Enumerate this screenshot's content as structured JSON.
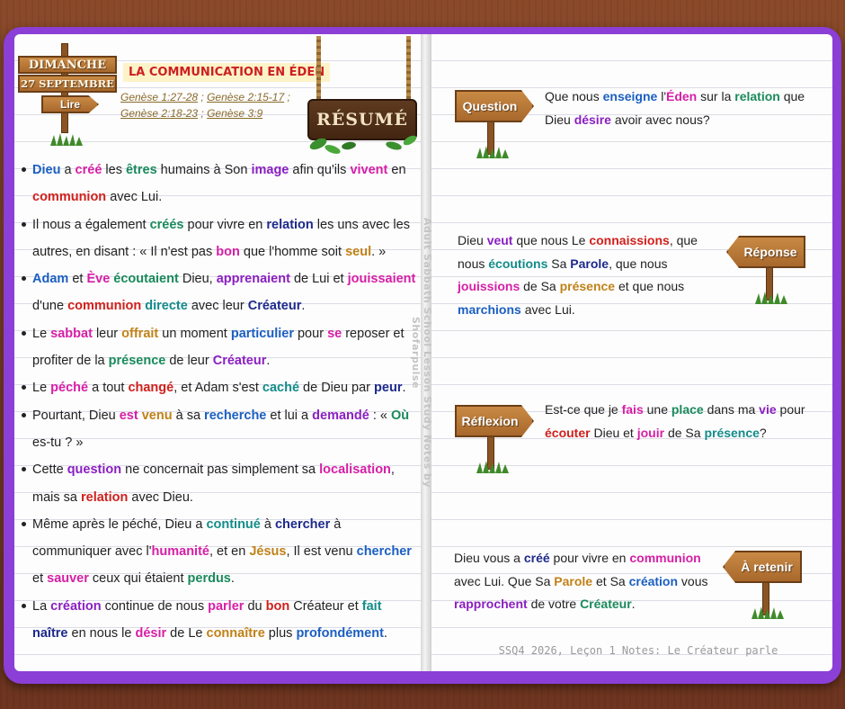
{
  "left_page": {
    "day_sign": {
      "day": "DIMANCHE",
      "date": "27 SEPTEMBRE",
      "read_label": "Lire"
    },
    "title": "LA COMMUNICATION EN ÉDEN",
    "references": [
      "Genèse 1:27-28",
      "Genèse 2:15-17",
      "Genèse 2:18-23",
      "Genèse 3:9"
    ],
    "resume_label": "RÉSUMÉ",
    "bullets": [
      [
        {
          "t": "Dieu",
          "c": "blue"
        },
        {
          "t": " a "
        },
        {
          "t": "créé",
          "c": "mag"
        },
        {
          "t": " les "
        },
        {
          "t": "êtres",
          "c": "grn"
        },
        {
          "t": " humains à Son "
        },
        {
          "t": "image",
          "c": "pur"
        },
        {
          "t": " afin qu'ils "
        },
        {
          "t": "vivent",
          "c": "mag"
        },
        {
          "t": " en "
        },
        {
          "t": "communion",
          "c": "red"
        },
        {
          "t": " avec Lui."
        }
      ],
      [
        {
          "t": "Il nous a également "
        },
        {
          "t": "créés",
          "c": "grn"
        },
        {
          "t": " pour vivre en "
        },
        {
          "t": "relation",
          "c": "navy"
        },
        {
          "t": " les uns avec les autres, en disant : « Il n'est pas "
        },
        {
          "t": "bon",
          "c": "mag"
        },
        {
          "t": " que l'homme soit "
        },
        {
          "t": "seul",
          "c": "gold"
        },
        {
          "t": ". »"
        }
      ],
      [
        {
          "t": "Adam",
          "c": "blue"
        },
        {
          "t": " et "
        },
        {
          "t": "Ève",
          "c": "mag"
        },
        {
          "t": " "
        },
        {
          "t": "écoutaient",
          "c": "grn"
        },
        {
          "t": " Dieu, "
        },
        {
          "t": "apprenaient",
          "c": "pur"
        },
        {
          "t": " de Lui et "
        },
        {
          "t": "jouissaient",
          "c": "mag"
        },
        {
          "t": " d'une "
        },
        {
          "t": "communion",
          "c": "red"
        },
        {
          "t": " "
        },
        {
          "t": "directe",
          "c": "teal"
        },
        {
          "t": " avec leur "
        },
        {
          "t": "Créateur",
          "c": "navy"
        },
        {
          "t": "."
        }
      ],
      [
        {
          "t": "Le "
        },
        {
          "t": "sabbat",
          "c": "mag"
        },
        {
          "t": " leur "
        },
        {
          "t": "offrait",
          "c": "gold"
        },
        {
          "t": " un moment "
        },
        {
          "t": "particulier",
          "c": "blue"
        },
        {
          "t": " pour "
        },
        {
          "t": "se",
          "c": "mag"
        },
        {
          "t": " reposer et profiter de la "
        },
        {
          "t": "présence",
          "c": "grn"
        },
        {
          "t": " de leur "
        },
        {
          "t": "Créateur",
          "c": "pur"
        },
        {
          "t": "."
        }
      ],
      [
        {
          "t": "Le "
        },
        {
          "t": "péché",
          "c": "mag"
        },
        {
          "t": " a tout "
        },
        {
          "t": "changé",
          "c": "red"
        },
        {
          "t": ", et Adam s'est "
        },
        {
          "t": "caché",
          "c": "teal"
        },
        {
          "t": " de Dieu par "
        },
        {
          "t": "peur",
          "c": "navy"
        },
        {
          "t": "."
        }
      ],
      [
        {
          "t": "Pourtant, Dieu "
        },
        {
          "t": "est",
          "c": "mag"
        },
        {
          "t": " "
        },
        {
          "t": "venu",
          "c": "gold"
        },
        {
          "t": " à sa "
        },
        {
          "t": "recherche",
          "c": "blue"
        },
        {
          "t": " et lui a "
        },
        {
          "t": "demandé",
          "c": "pur"
        },
        {
          "t": " : « "
        },
        {
          "t": "Où",
          "c": "grn"
        },
        {
          "t": " es-tu ? »"
        }
      ],
      [
        {
          "t": "Cette "
        },
        {
          "t": "question",
          "c": "pur"
        },
        {
          "t": " ne concernait pas simplement sa "
        },
        {
          "t": "localisation",
          "c": "mag"
        },
        {
          "t": ", mais sa "
        },
        {
          "t": "relation",
          "c": "red"
        },
        {
          "t": " avec Dieu."
        }
      ],
      [
        {
          "t": "Même après le péché, Dieu a "
        },
        {
          "t": "continué",
          "c": "teal"
        },
        {
          "t": " à "
        },
        {
          "t": "chercher",
          "c": "navy"
        },
        {
          "t": " à communiquer avec l'"
        },
        {
          "t": "humanité",
          "c": "mag"
        },
        {
          "t": ", et en "
        },
        {
          "t": "Jésus",
          "c": "gold"
        },
        {
          "t": ", Il est venu "
        },
        {
          "t": "chercher",
          "c": "blue"
        },
        {
          "t": " et "
        },
        {
          "t": "sauver",
          "c": "mag"
        },
        {
          "t": " ceux qui étaient "
        },
        {
          "t": "perdus",
          "c": "grn"
        },
        {
          "t": "."
        }
      ],
      [
        {
          "t": "La "
        },
        {
          "t": "création",
          "c": "pur"
        },
        {
          "t": " continue de nous "
        },
        {
          "t": "parler",
          "c": "mag"
        },
        {
          "t": " du "
        },
        {
          "t": "bon",
          "c": "red"
        },
        {
          "t": " Créateur et "
        },
        {
          "t": "fait",
          "c": "teal"
        },
        {
          "t": " "
        },
        {
          "t": "naître",
          "c": "navy"
        },
        {
          "t": " en nous le "
        },
        {
          "t": "désir",
          "c": "mag"
        },
        {
          "t": " de Le "
        },
        {
          "t": "connaître",
          "c": "gold"
        },
        {
          "t": " plus "
        },
        {
          "t": "profondément",
          "c": "blue"
        },
        {
          "t": "."
        }
      ]
    ]
  },
  "spine_credit": "Adult Sabbath School Lesson Study Notes by Shofarpulse",
  "right_page": {
    "sections": [
      {
        "sign": "Question",
        "text": [
          {
            "t": "Que nous "
          },
          {
            "t": "enseigne",
            "c": "blue"
          },
          {
            "t": " l'"
          },
          {
            "t": "Éden",
            "c": "mag"
          },
          {
            "t": " sur la "
          },
          {
            "t": "relation",
            "c": "grn"
          },
          {
            "t": " que Dieu "
          },
          {
            "t": "désire",
            "c": "pur"
          },
          {
            "t": " avoir avec nous?"
          }
        ]
      },
      {
        "sign": "Réponse",
        "text": [
          {
            "t": "Dieu "
          },
          {
            "t": "veut",
            "c": "pur"
          },
          {
            "t": " que nous Le "
          },
          {
            "t": "connaissions",
            "c": "red"
          },
          {
            "t": ", que nous "
          },
          {
            "t": "écoutions",
            "c": "teal"
          },
          {
            "t": " Sa "
          },
          {
            "t": "Parole",
            "c": "navy"
          },
          {
            "t": ", que nous "
          },
          {
            "t": "jouissions",
            "c": "mag"
          },
          {
            "t": " de Sa "
          },
          {
            "t": "présence",
            "c": "gold"
          },
          {
            "t": " et que nous "
          },
          {
            "t": "marchions",
            "c": "blue"
          },
          {
            "t": " avec Lui."
          }
        ]
      },
      {
        "sign": "Réflexion",
        "text": [
          {
            "t": "Est-ce que je "
          },
          {
            "t": "fais",
            "c": "mag"
          },
          {
            "t": " une "
          },
          {
            "t": "place",
            "c": "grn"
          },
          {
            "t": " dans ma "
          },
          {
            "t": "vie",
            "c": "pur"
          },
          {
            "t": " pour "
          },
          {
            "t": "écouter",
            "c": "red"
          },
          {
            "t": " Dieu et "
          },
          {
            "t": "jouir",
            "c": "mag"
          },
          {
            "t": " de Sa "
          },
          {
            "t": "présence",
            "c": "teal"
          },
          {
            "t": "?"
          }
        ]
      },
      {
        "sign": "À retenir",
        "text": [
          {
            "t": "Dieu vous a "
          },
          {
            "t": "créé",
            "c": "navy"
          },
          {
            "t": " pour vivre en "
          },
          {
            "t": "communion",
            "c": "mag"
          },
          {
            "t": " avec Lui. Que Sa "
          },
          {
            "t": "Parole",
            "c": "gold"
          },
          {
            "t": " et Sa "
          },
          {
            "t": "création",
            "c": "blue"
          },
          {
            "t": " vous "
          },
          {
            "t": "rapprochent",
            "c": "pur"
          },
          {
            "t": " de votre "
          },
          {
            "t": "Créateur",
            "c": "grn"
          },
          {
            "t": "."
          }
        ]
      }
    ],
    "footer": "SSQ4 2026, Leçon 1 Notes: Le Créateur parle"
  },
  "colors": {
    "notebook_cover": "#8b3fd6",
    "background_wood": "#7a3e22",
    "sign_wood": "#b87838",
    "title_red": "#cc2020",
    "title_highlight": "#fdf3c8"
  }
}
